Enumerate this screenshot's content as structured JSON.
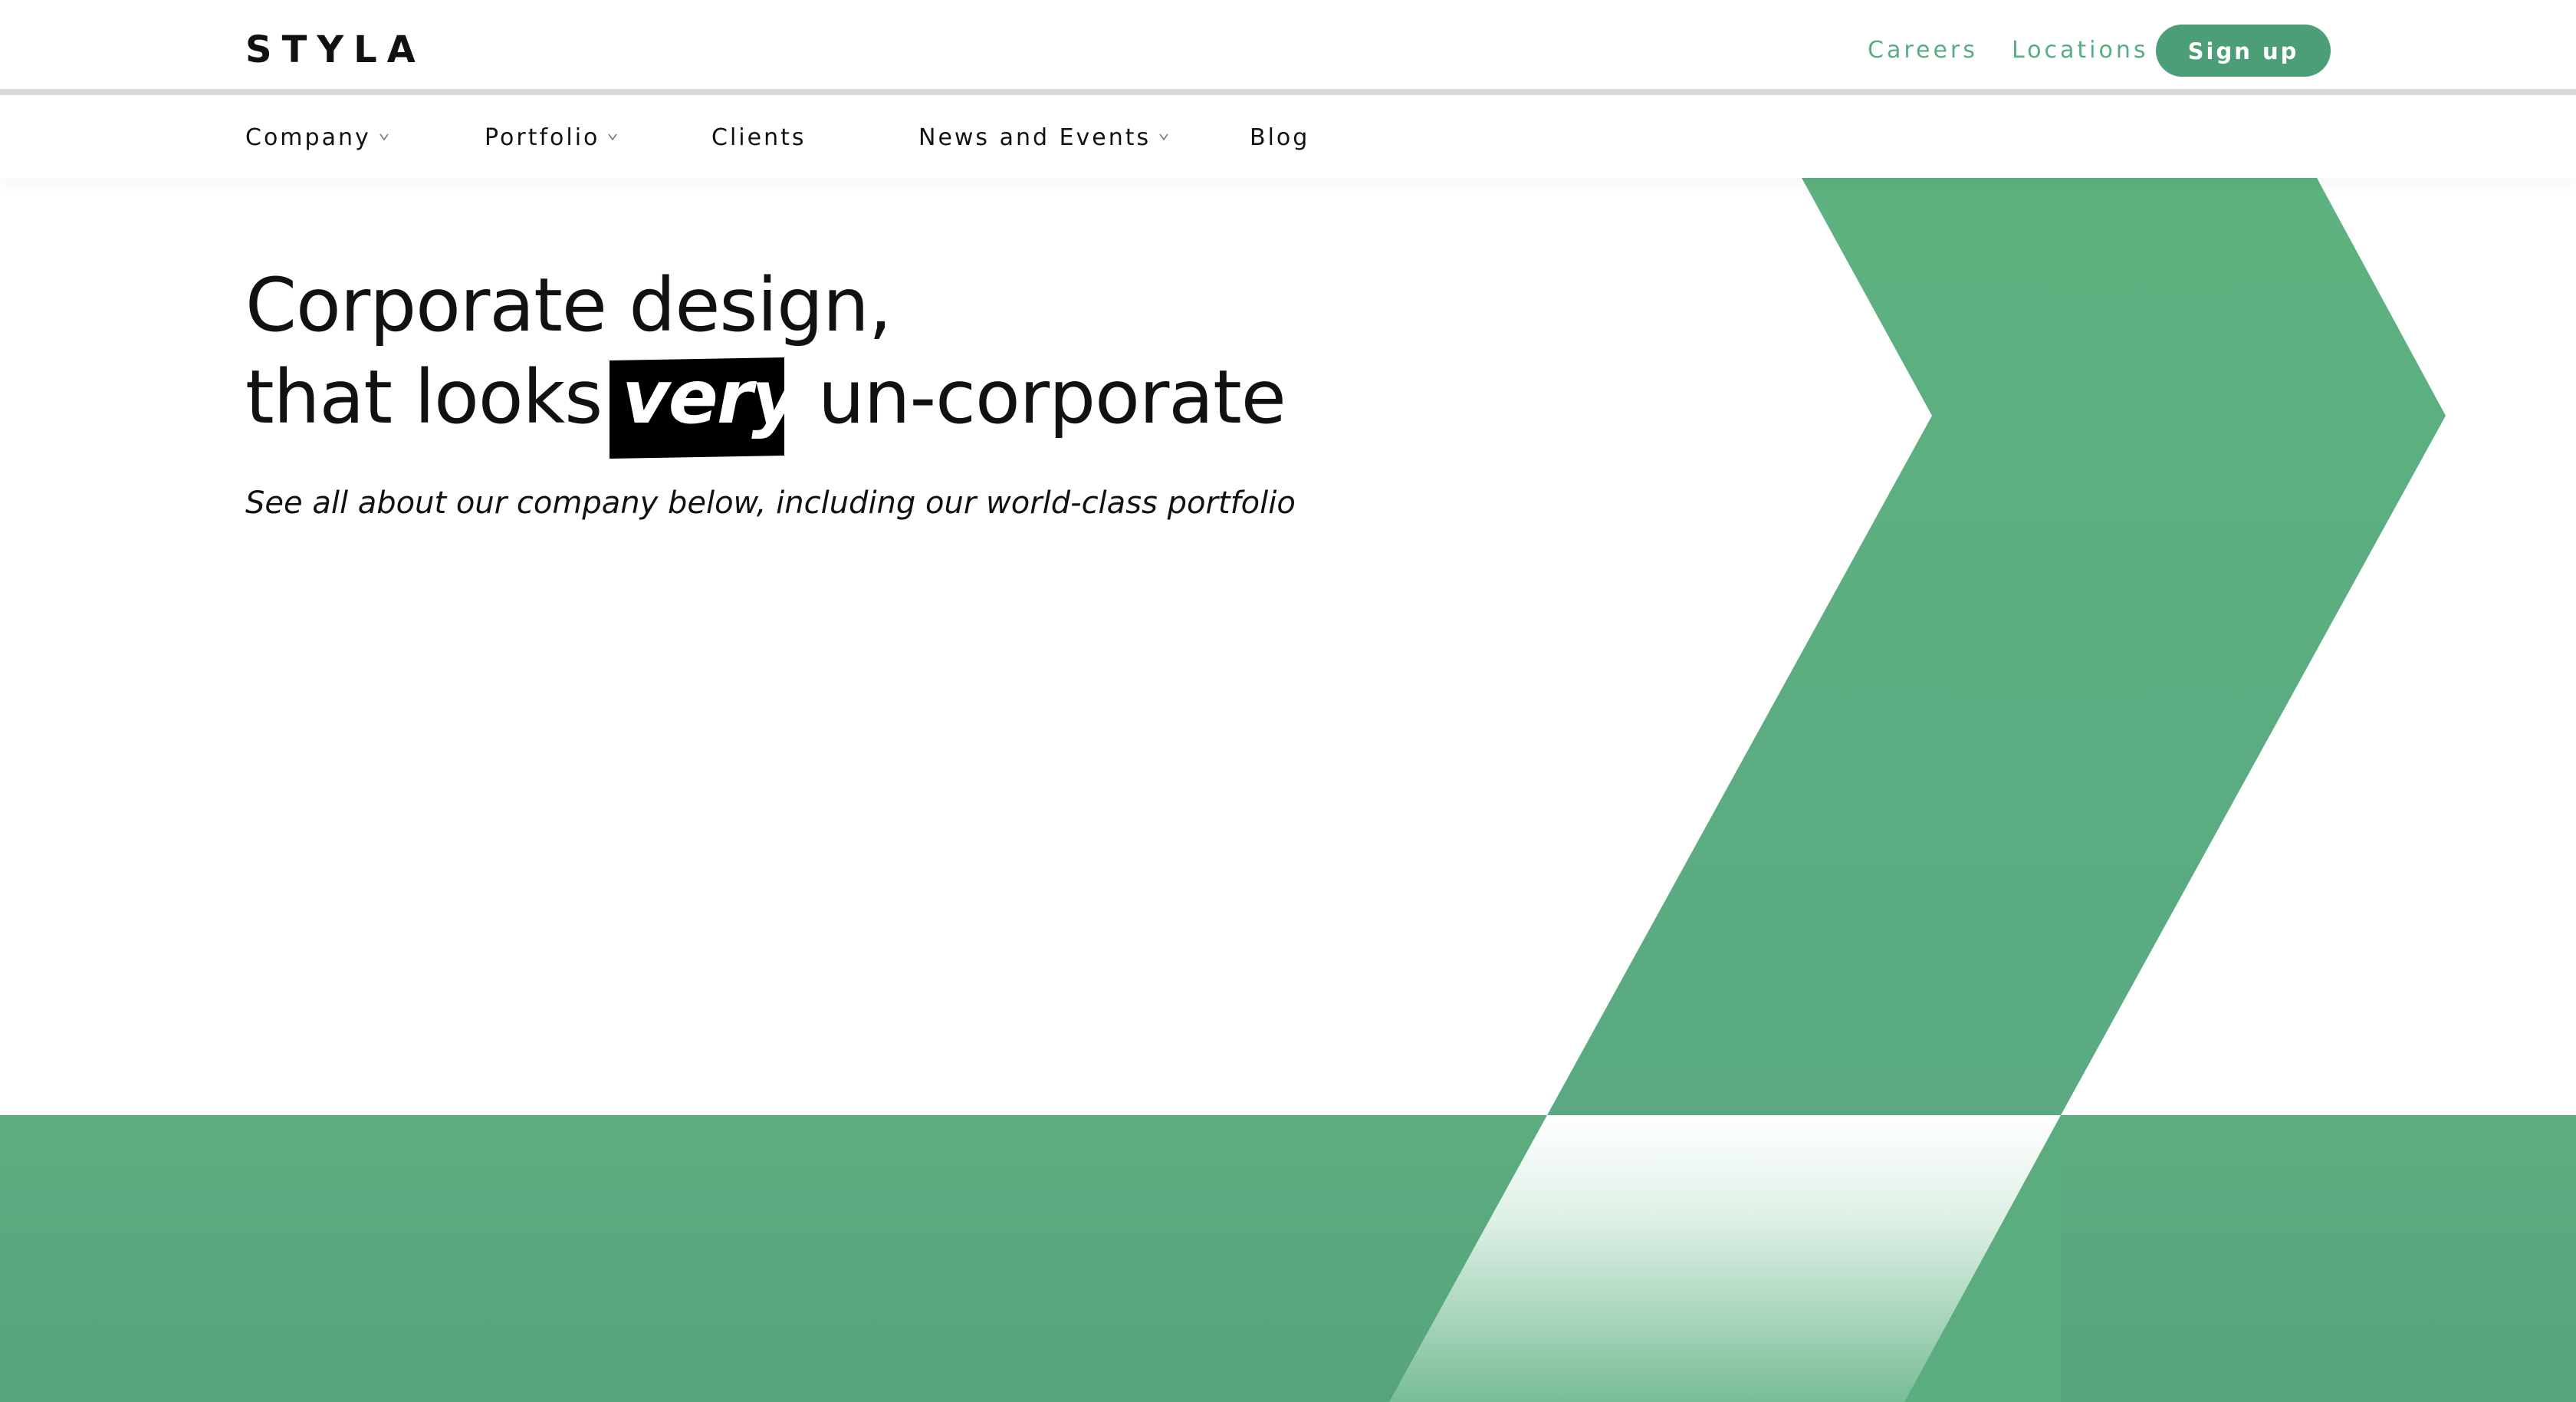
{
  "header": {
    "logo": "STYLA",
    "careers_label": "Careers",
    "locations_label": "Locations",
    "signup_label": "Sign up"
  },
  "main_nav": {
    "items": [
      {
        "label": "Company",
        "has_dropdown": true
      },
      {
        "label": "Portfolio",
        "has_dropdown": true
      },
      {
        "label": "Clients",
        "has_dropdown": false
      },
      {
        "label": "News and Events",
        "has_dropdown": true
      },
      {
        "label": "Blog",
        "has_dropdown": false
      }
    ]
  },
  "hero": {
    "headline_line_1": "Corporate design,",
    "headline_line_2_prefix": "that looks",
    "headline_highlight": "very",
    "headline_line_2_suffix": "un-corporate",
    "subtitle": "See all about our company below, including our world-class portfolio"
  },
  "icons": {
    "dropdown": "chevron-down-icon"
  },
  "colors": {
    "accent": "#58ad81",
    "button": "#4c9e78",
    "text": "#111111",
    "highlight_background": "#000000",
    "hero_green": "#5bad80"
  }
}
